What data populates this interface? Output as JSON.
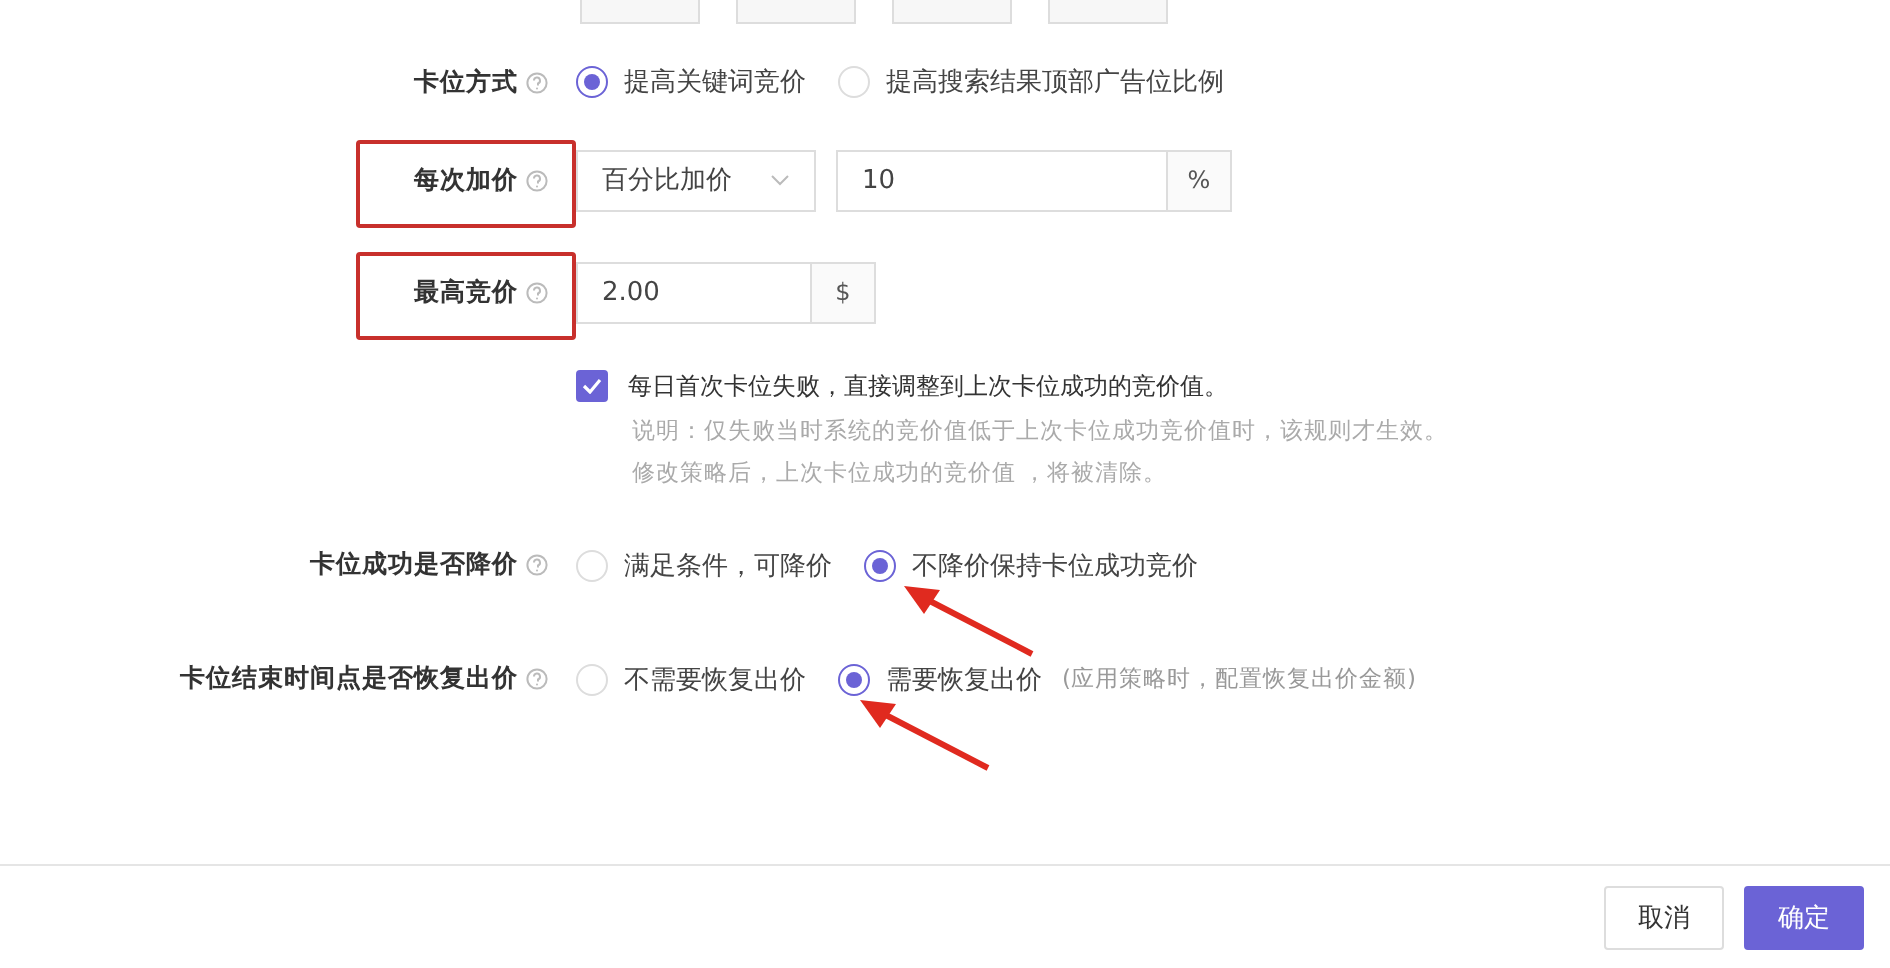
{
  "top_fields": [
    {
      "kind": "input"
    },
    {
      "kind": "input"
    },
    {
      "kind": "input"
    },
    {
      "kind": "input"
    }
  ],
  "rows": [
    {
      "kind": "radio",
      "label": "卡位方式",
      "options": [
        {
          "label": "提高关键词竞价",
          "selected": true
        },
        {
          "label": "提高搜索结果顶部广告位比例",
          "selected": false
        }
      ]
    },
    {
      "kind": "select_input",
      "label": "每次加价",
      "highlighted": true,
      "select": "百分比加价",
      "value": "10",
      "unit": "%"
    },
    {
      "kind": "input",
      "label": "最高竞价",
      "highlighted": true,
      "value": "2.00",
      "unit": "$"
    },
    {
      "kind": "checkbox",
      "checked": true,
      "text": "每日首次卡位失败，直接调整到上次卡位成功的竞价值。",
      "notes": [
        "说明：仅失败当时系统的竞价值低于上次卡位成功竞价值时，该规则才生效。",
        "修改策略后，上次卡位成功的竞价值 ，将被清除。"
      ]
    },
    {
      "kind": "radio",
      "label": "卡位成功是否降价",
      "arrow": true,
      "options": [
        {
          "label": "满足条件，可降价",
          "selected": false
        },
        {
          "label": "不降价保持卡位成功竞价",
          "selected": true
        }
      ]
    },
    {
      "kind": "radio",
      "label": "卡位结束时间点是否恢复出价",
      "arrow": true,
      "hint": "(应用策略时，配置恢复出价金额)",
      "options": [
        {
          "label": "不需要恢复出价",
          "selected": false
        },
        {
          "label": "需要恢复出价",
          "selected": true
        }
      ]
    }
  ],
  "buttons": [
    {
      "label": "取消",
      "primary": false
    },
    {
      "label": "确定",
      "primary": true
    }
  ]
}
